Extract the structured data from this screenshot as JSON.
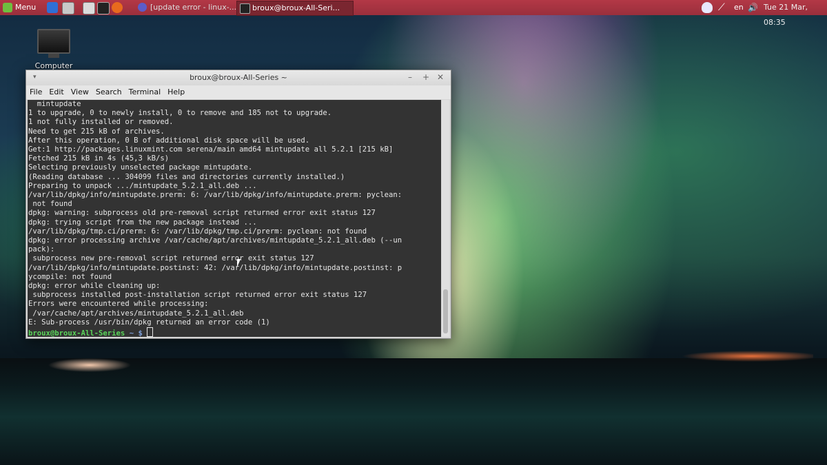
{
  "panel": {
    "menu_label": "Menu",
    "tasks": [
      {
        "label": "[update error - linux-..."
      },
      {
        "label": "broux@broux-All-Seri..."
      }
    ],
    "tray": {
      "lang": "en",
      "clock": "Tue 21 Mar, 08:35"
    }
  },
  "desktop": {
    "computer_label": "Computer"
  },
  "terminal": {
    "title": "broux@broux-All-Series ~",
    "menu": [
      "File",
      "Edit",
      "View",
      "Search",
      "Terminal",
      "Help"
    ],
    "lines": [
      "  mintupdate",
      "1 to upgrade, 0 to newly install, 0 to remove and 185 not to upgrade.",
      "1 not fully installed or removed.",
      "Need to get 215 kB of archives.",
      "After this operation, 0 B of additional disk space will be used.",
      "Get:1 http://packages.linuxmint.com serena/main amd64 mintupdate all 5.2.1 [215 kB]",
      "Fetched 215 kB in 4s (45,3 kB/s)",
      "Selecting previously unselected package mintupdate.",
      "(Reading database ... 304099 files and directories currently installed.)",
      "Preparing to unpack .../mintupdate_5.2.1_all.deb ...",
      "/var/lib/dpkg/info/mintupdate.prerm: 6: /var/lib/dpkg/info/mintupdate.prerm: pyclean:",
      " not found",
      "dpkg: warning: subprocess old pre-removal script returned error exit status 127",
      "dpkg: trying script from the new package instead ...",
      "/var/lib/dpkg/tmp.ci/prerm: 6: /var/lib/dpkg/tmp.ci/prerm: pyclean: not found",
      "dpkg: error processing archive /var/cache/apt/archives/mintupdate_5.2.1_all.deb (--un",
      "pack):",
      " subprocess new pre-removal script returned error exit status 127",
      "/var/lib/dpkg/info/mintupdate.postinst: 42: /var/lib/dpkg/info/mintupdate.postinst: p",
      "ycompile: not found",
      "dpkg: error while cleaning up:",
      " subprocess installed post-installation script returned error exit status 127",
      "Errors were encountered while processing:",
      " /var/cache/apt/archives/mintupdate_5.2.1_all.deb",
      "E: Sub-process /usr/bin/dpkg returned an error code (1)"
    ],
    "prompt_user": "broux@broux-All-Series",
    "prompt_tilde": "~ $"
  }
}
